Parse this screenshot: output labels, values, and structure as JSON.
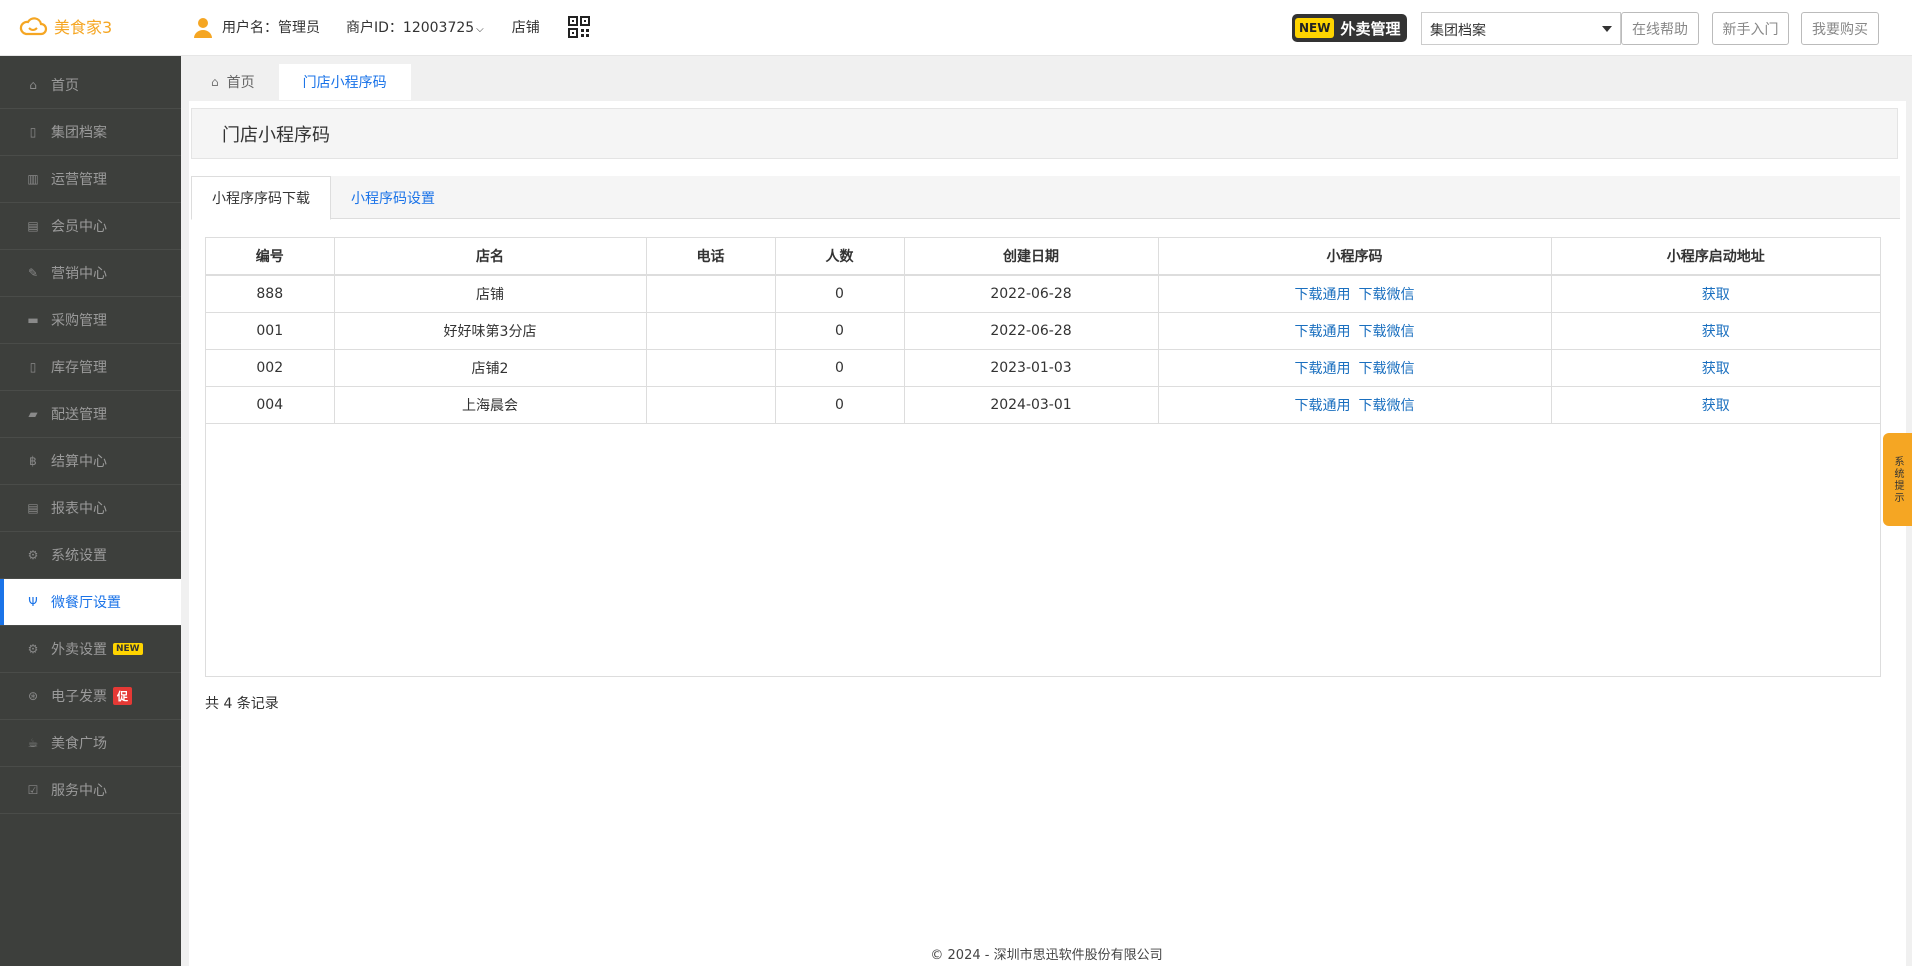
{
  "app": {
    "logo_text": "美食家3"
  },
  "header": {
    "username_label": "用户名：管理员",
    "merchant_label": "商户ID：12003725",
    "store_label": "店铺",
    "waimai_badge_new": "NEW",
    "waimai_label": "外卖管理",
    "select_value": "集团档案",
    "help_btn": "在线帮助",
    "newbie_btn": "新手入门",
    "buy_btn": "我要购买"
  },
  "sidebar": {
    "items": [
      {
        "label": "首页",
        "icon": "home-icon"
      },
      {
        "label": "集团档案",
        "icon": "file-icon"
      },
      {
        "label": "运营管理",
        "icon": "chart-icon"
      },
      {
        "label": "会员中心",
        "icon": "id-card-icon"
      },
      {
        "label": "营销中心",
        "icon": "edit-icon"
      },
      {
        "label": "采购管理",
        "icon": "book-icon"
      },
      {
        "label": "库存管理",
        "icon": "building-icon"
      },
      {
        "label": "配送管理",
        "icon": "truck-icon"
      },
      {
        "label": "结算中心",
        "icon": "bitcoin-icon"
      },
      {
        "label": "报表中心",
        "icon": "report-icon"
      },
      {
        "label": "系统设置",
        "icon": "gears-icon"
      },
      {
        "label": "微餐厅设置",
        "icon": "cutlery-icon",
        "active": true
      },
      {
        "label": "外卖设置",
        "icon": "gear-icon",
        "tag": "NEW"
      },
      {
        "label": "电子发票",
        "icon": "ticket-icon",
        "tag": "促"
      },
      {
        "label": "美食广场",
        "icon": "coffee-icon"
      },
      {
        "label": "服务中心",
        "icon": "check-square-icon"
      }
    ]
  },
  "breadcrumb": {
    "home": "首页",
    "current": "门店小程序码"
  },
  "page": {
    "title": "门店小程序码"
  },
  "tabs": {
    "download": "小程序序码下载",
    "settings": "小程序码设置"
  },
  "table": {
    "columns": [
      "编号",
      "店名",
      "电话",
      "人数",
      "创建日期",
      "小程序码",
      "小程序启动地址"
    ],
    "rows": [
      {
        "code": "888",
        "name": "店铺",
        "phone": "",
        "count": "0",
        "date": "2022-06-28",
        "dl_general": "下载通用",
        "dl_wechat": "下载微信",
        "get": "获取"
      },
      {
        "code": "001",
        "name": "好好味第3分店",
        "phone": "",
        "count": "0",
        "date": "2022-06-28",
        "dl_general": "下载通用",
        "dl_wechat": "下载微信",
        "get": "获取"
      },
      {
        "code": "002",
        "name": "店铺2",
        "phone": "",
        "count": "0",
        "date": "2023-01-03",
        "dl_general": "下载通用",
        "dl_wechat": "下载微信",
        "get": "获取"
      },
      {
        "code": "004",
        "name": "上海晨会",
        "phone": "",
        "count": "0",
        "date": "2024-03-01",
        "dl_general": "下载通用",
        "dl_wechat": "下载微信",
        "get": "获取"
      }
    ]
  },
  "records": "共 4 条记录",
  "footer": "© 2024 - 深圳市思迅软件股份有限公司",
  "sys_tip": "系统提示",
  "colors": {
    "accent": "#1a73e8",
    "sidebar_bg": "#3d3f3c",
    "logo": "#f5a623",
    "tag_new": "#ffd400",
    "tag_cu": "#e53935"
  }
}
